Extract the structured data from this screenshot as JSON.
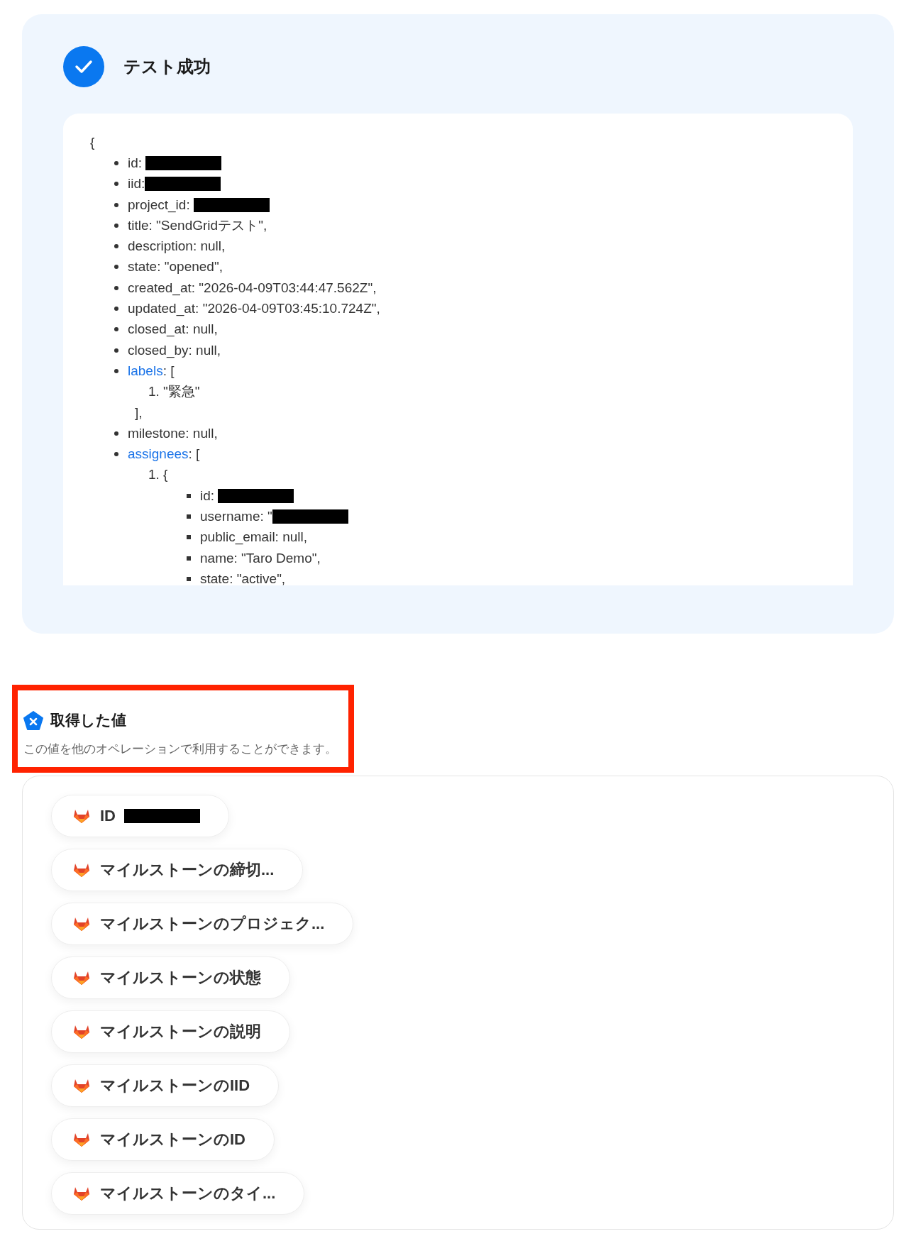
{
  "result": {
    "title": "テスト成功",
    "open_brace": "{",
    "fields": [
      {
        "kind": "plain",
        "text": "id: ",
        "redacted": true
      },
      {
        "kind": "plain",
        "text": "iid:",
        "redacted": true
      },
      {
        "kind": "plain",
        "text": "project_id: ",
        "redacted": true
      },
      {
        "kind": "plain",
        "text": "title: \"SendGridテスト\","
      },
      {
        "kind": "plain",
        "text": "description: null,"
      },
      {
        "kind": "plain",
        "text": "state: \"opened\","
      },
      {
        "kind": "plain",
        "text": "created_at: \"2026-04-09T03:44:47.562Z\","
      },
      {
        "kind": "plain",
        "text": "updated_at: \"2026-04-09T03:45:10.724Z\","
      },
      {
        "kind": "plain",
        "text": "closed_at: null,"
      },
      {
        "kind": "plain",
        "text": "closed_by: null,"
      },
      {
        "kind": "link",
        "key": "labels",
        "text": ": [",
        "items": [
          {
            "number": "1.",
            "text": "\"緊急\""
          }
        ],
        "close": "],"
      },
      {
        "kind": "plain",
        "text": "milestone: null,"
      },
      {
        "kind": "link",
        "key": "assignees",
        "text": ": [",
        "items": [
          {
            "number": "1.",
            "text": "{",
            "fields": [
              {
                "text": "id: ",
                "redacted": true
              },
              {
                "text": "username: \"",
                "redacted": true
              },
              {
                "text": "public_email: null,"
              },
              {
                "text": "name: \"Taro Demo\","
              },
              {
                "text": "state: \"active\","
              }
            ]
          }
        ]
      }
    ]
  },
  "values": {
    "title": "取得した値",
    "description": "この値を他のオペレーションで利用することができます。",
    "items": [
      {
        "label": "ID ",
        "redacted": true
      },
      {
        "label": "マイルストーンの締切..."
      },
      {
        "label": "マイルストーンのプロジェク..."
      },
      {
        "label": "マイルストーンの状態"
      },
      {
        "label": "マイルストーンの説明"
      },
      {
        "label": "マイルストーンのIID"
      },
      {
        "label": "マイルストーンのID"
      },
      {
        "label": "マイルストーンのタイ..."
      }
    ]
  }
}
